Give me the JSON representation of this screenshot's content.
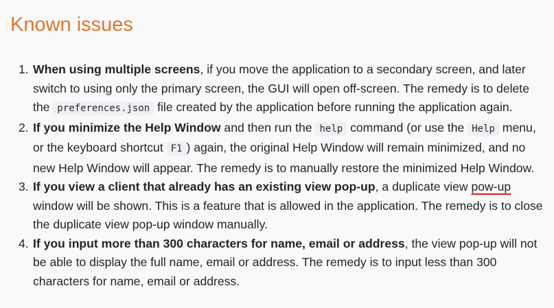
{
  "heading": "Known issues",
  "issues": [
    {
      "number": "1.",
      "lead": "When using multiple screens",
      "text_1": ", if you move the application to a secondary screen, and later switch to using only the primary screen, the GUI will open off-screen. The remedy is to delete the ",
      "code_1": "preferences.json",
      "text_2": " file created by the application before running the application again."
    },
    {
      "number": "2.",
      "lead": "If you minimize the Help Window",
      "text_1": " and then run the ",
      "code_1": "help",
      "text_2": " command (or use the ",
      "code_2": "Help",
      "text_3": " menu, or the keyboard shortcut ",
      "code_3": "F1",
      "text_4": ") again, the original Help Window will remain minimized, and no new Help Window will appear. The remedy is to manually restore the minimized Help Window."
    },
    {
      "number": "3.",
      "lead": "If you view a client that already has an existing view pop-up",
      "text_1": ", a duplicate view ",
      "squiggle_word": "pow-up",
      "text_2": " window will be shown. This is a feature that is allowed in the application. The remedy is to close the duplicate view pop-up window manually."
    },
    {
      "number": "4.",
      "lead": "If you input more than 300 characters for name, email or address",
      "text_1": ", the view pop-up will not be able to display the full name, email or address. The remedy is to input less than 300 characters for name, email or address."
    }
  ],
  "colors": {
    "heading": "#e0762b",
    "spellcheck_underline": "#d11b1b",
    "code_background": "#eef0f5"
  }
}
